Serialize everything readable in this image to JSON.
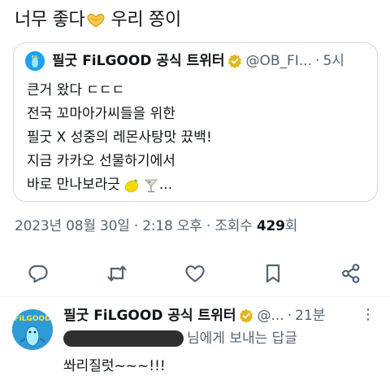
{
  "tweet": {
    "text_before": "너무 좋다",
    "text_after": "우리 쫑이",
    "icon": "heart-hands-icon"
  },
  "quote": {
    "display_name": "필굿 FiLGOOD 공식 트위터",
    "handle": "@OB_FI...",
    "separator": "·",
    "time": "5시",
    "lines": [
      "큰거 왔다 ㄷㄷㄷ",
      "전국 꼬마아가씨들을 위한",
      "필굿 X 성중의 레몬사탕맛 끘백!",
      "지금 카카오 선물하기에서",
      "바로 만나보라긋"
    ],
    "line5_suffix": "...",
    "line5_emojis": [
      "lemon-icon",
      "cocktail-icon"
    ]
  },
  "meta": {
    "datetime": "2023년 08월 30일 · 2:18 오후 · 조회수 ",
    "views": "429",
    "views_suffix": "회"
  },
  "actions": [
    "reply-icon",
    "retweet-icon",
    "like-icon",
    "bookmark-icon",
    "share-icon"
  ],
  "reply": {
    "display_name": "필굿 FiLGOOD 공식 트위터",
    "handle": "@...",
    "separator": "·",
    "time": "21분",
    "more": "⋮",
    "to_text": "님에게 보내는 답글",
    "text": "쏴리질럿~~~!!!"
  },
  "colors": {
    "text": "#0f1419",
    "secondary": "#536471",
    "border": "#cfd9de",
    "verified_gold": "#e2b719",
    "brand_blue": "#1da1f2"
  }
}
